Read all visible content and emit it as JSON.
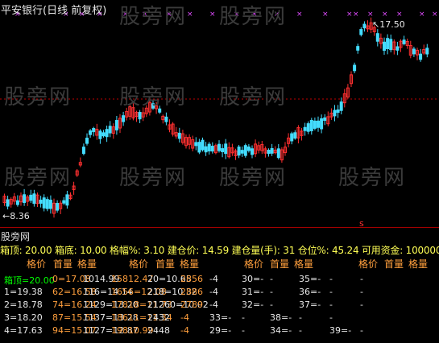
{
  "title": "平安银行(日线 前复权)",
  "watermark": "股旁网",
  "price_labels": {
    "high": "17.50",
    "low": "←8.36"
  },
  "signal_marker": "s",
  "indicator": {
    "name": "股旁网",
    "params_text": "箱顶: 20.00  箱底: 10.00  格幅%: 3.10  建仓价: 14.59  建仓量(手): 31  仓位%: 45.24  可用资金: 100000",
    "headers": [
      "格价",
      "首量",
      "格量",
      "格价",
      "首量",
      "格量",
      "格价",
      "首量",
      "格量",
      "格价",
      "首量",
      "格量"
    ],
    "rows": [
      {
        "label": "箱顶=20.00",
        "cells": [
          "0=17.08",
          "1014.99",
          "15812.47",
          "20=10.65",
          "2856",
          "-4",
          "30=-",
          "-",
          "35=-",
          "-",
          "-"
        ]
      },
      {
        "label": "1=19.38",
        "cells": [
          "62=16.58",
          "116=14.14",
          "1656=12.08",
          "218=10.32",
          "2886",
          "-4",
          "31=-",
          "-",
          "36=-",
          "-",
          "-"
        ]
      },
      {
        "label": "2=18.78",
        "cells": [
          "74=16.24",
          "1129=13.20",
          "17818=11.73",
          "21260=10.02",
          "2789",
          "-4",
          "32=-",
          "-",
          "37=-",
          "-",
          "-"
        ]
      },
      {
        "label": "3=18.20",
        "cells": [
          "87=15.54",
          "1137=13.28",
          "18611=11.34",
          "2432",
          "-4",
          "33=-",
          "-",
          "38=-",
          "-",
          "-"
        ]
      },
      {
        "label": "4=17.63",
        "cells": [
          "94=15.07",
          "1127=12.87",
          "19810.99",
          "2448",
          "-4",
          "29=-",
          "-",
          "34=-",
          "-",
          "39=-",
          "-"
        ]
      }
    ]
  },
  "colors": {
    "up": "#ff3030",
    "down": "#44ddff",
    "cross": "#e04bff",
    "bg": "#000000"
  }
}
